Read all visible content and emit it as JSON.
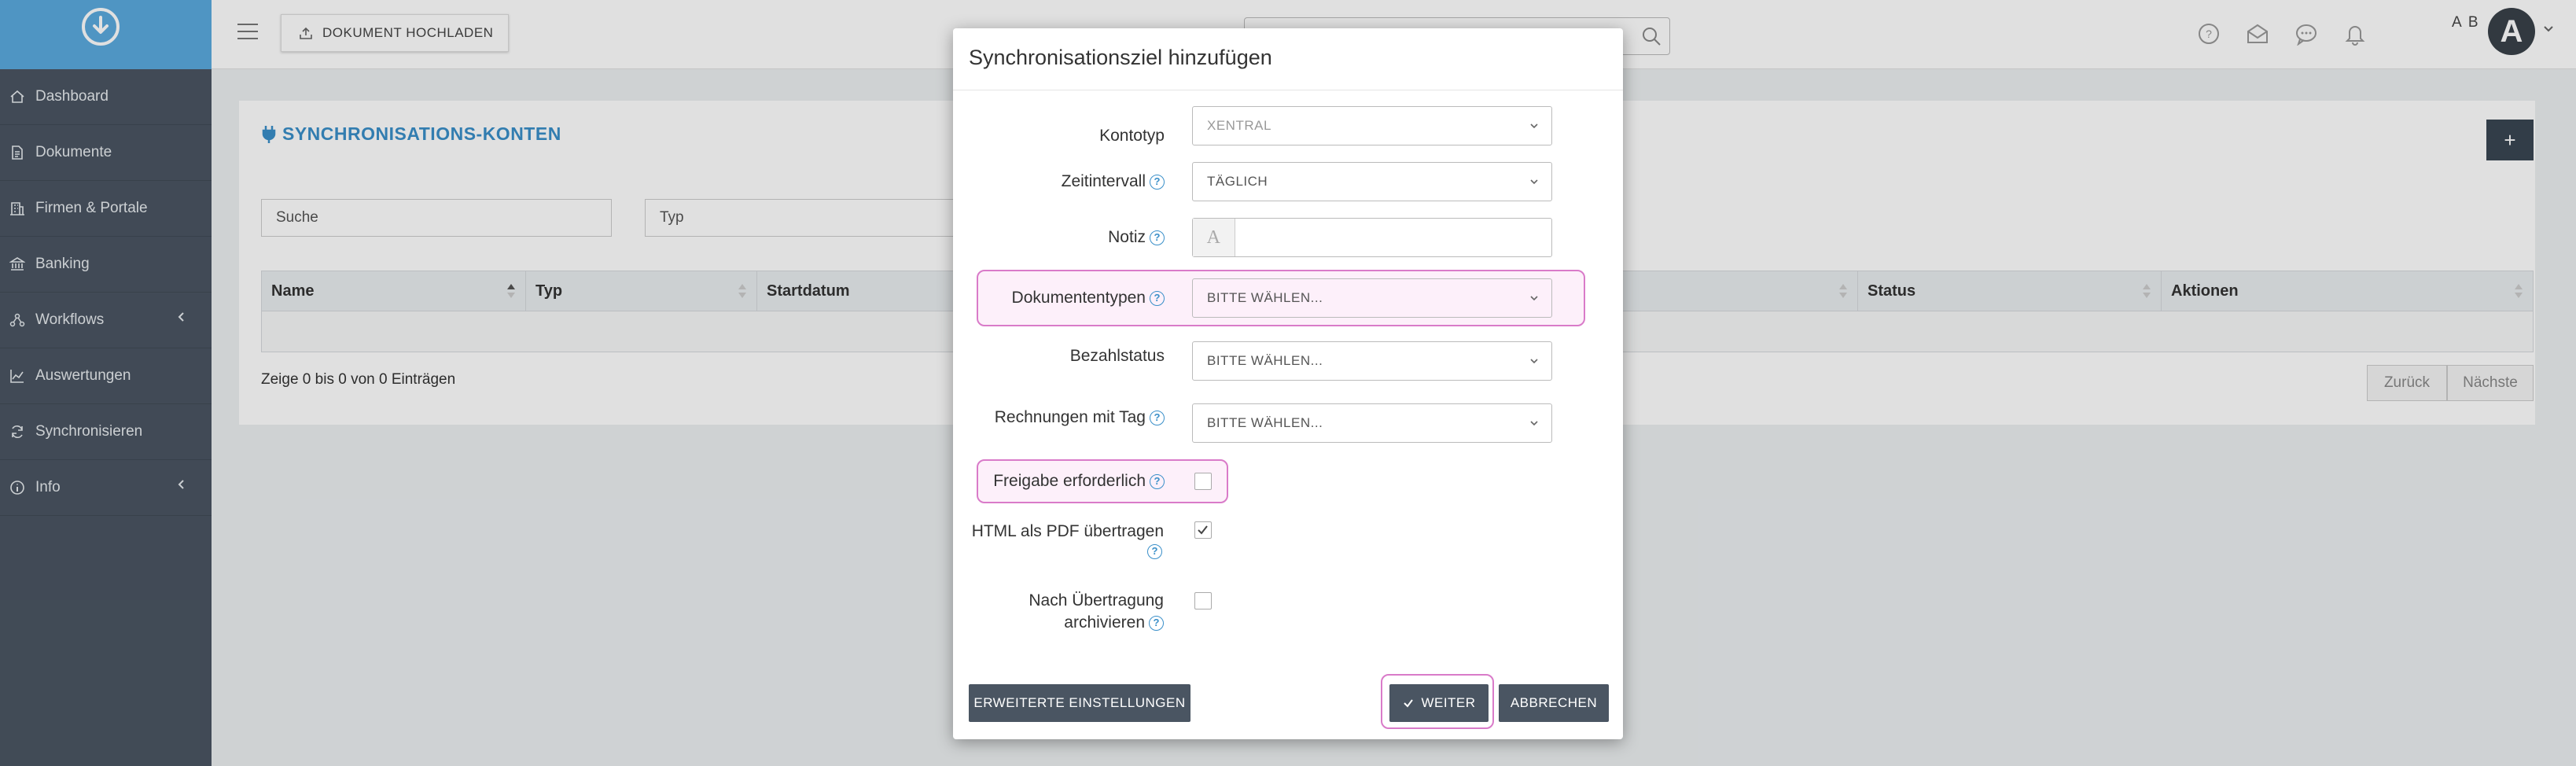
{
  "topbar": {
    "upload_label": "DOKUMENT HOCHLADEN",
    "user_initials": "A B",
    "avatar_letter": "A"
  },
  "sidebar": {
    "items": [
      {
        "label": "Dashboard",
        "icon": "home-icon"
      },
      {
        "label": "Dokumente",
        "icon": "document-icon"
      },
      {
        "label": "Firmen & Portale",
        "icon": "building-icon"
      },
      {
        "label": "Banking",
        "icon": "bank-icon"
      },
      {
        "label": "Workflows",
        "icon": "workflow-icon"
      },
      {
        "label": "Auswertungen",
        "icon": "chart-icon"
      },
      {
        "label": "Synchronisieren",
        "icon": "sync-icon"
      },
      {
        "label": "Info",
        "icon": "info-icon"
      }
    ]
  },
  "main": {
    "title": "SYNCHRONISATIONS-KONTEN",
    "add_label": "+",
    "search_placeholder": "Suche",
    "type_placeholder": "Typ",
    "columns": [
      "Name",
      "Typ",
      "Startdatum",
      "Status",
      "Aktionen"
    ],
    "entries_info": "Zeige 0 bis 0 von 0 Einträgen",
    "prev_label": "Zurück",
    "next_label": "Nächste"
  },
  "modal": {
    "title": "Synchronisationsziel hinzufügen",
    "fields": {
      "kontotyp": {
        "label": "Kontotyp",
        "value": "XENTRAL"
      },
      "zeitintervall": {
        "label": "Zeitintervall",
        "value": "TÄGLICH"
      },
      "notiz": {
        "label": "Notiz",
        "prefix": "A",
        "value": ""
      },
      "dokumententypen": {
        "label": "Dokumententypen",
        "value": "BITTE WÄHLEN..."
      },
      "bezahlstatus": {
        "label": "Bezahlstatus",
        "value": "BITTE WÄHLEN..."
      },
      "rechnungen_tag": {
        "label": "Rechnungen mit Tag",
        "value": "BITTE WÄHLEN..."
      },
      "freigabe": {
        "label": "Freigabe erforderlich",
        "checked": false
      },
      "html_pdf": {
        "label": "HTML als PDF übertragen",
        "checked": true
      },
      "archivieren": {
        "label_line1": "Nach Übertragung",
        "label_line2": "archivieren",
        "checked": false
      }
    },
    "buttons": {
      "advanced": "ERWEITERTE EINSTELLUNGEN",
      "next": "WEITER",
      "cancel": "ABBRECHEN"
    }
  },
  "colors": {
    "sidebar_bg": "#4a5562",
    "brand_blue": "#5aaadf",
    "title_blue": "#3a8fc9",
    "highlight_pink": "#d97bc9"
  }
}
